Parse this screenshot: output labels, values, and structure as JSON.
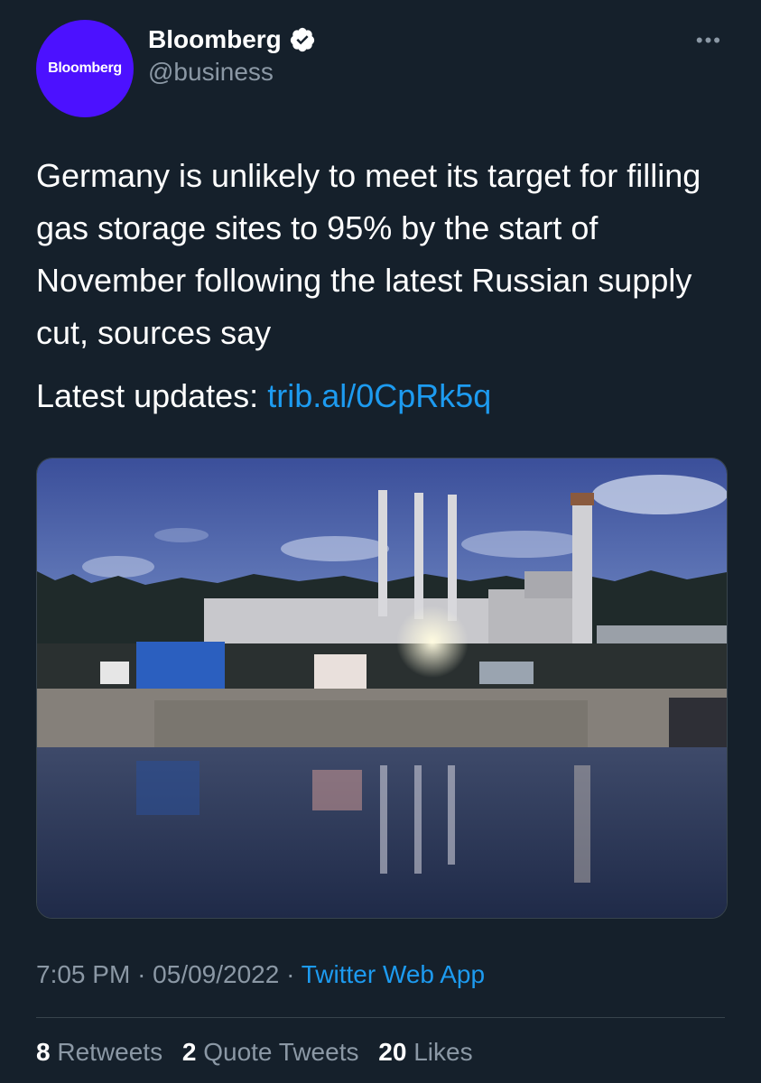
{
  "author": {
    "avatar_text": "Bloomberg",
    "display_name": "Bloomberg",
    "handle": "@business",
    "verified": true
  },
  "icons": {
    "verified": "verified-badge-icon",
    "more": "more-options-icon"
  },
  "more_label": "•••",
  "tweet": {
    "text": "Germany is unlikely to meet its target for filling gas storage sites to 95% by the start of November following the latest Russian supply cut, sources say",
    "updates_label": "Latest updates:",
    "link_text": "trib.al/0CpRk5q"
  },
  "meta": {
    "time": "7:05 PM",
    "separator": "·",
    "date": "05/09/2022",
    "source": "Twitter Web App"
  },
  "stats": {
    "retweets_count": "8",
    "retweets_label": "Retweets",
    "quotes_count": "2",
    "quotes_label": "Quote Tweets",
    "likes_count": "20",
    "likes_label": "Likes"
  },
  "colors": {
    "background": "#15202b",
    "secondary_text": "#8b98a5",
    "link": "#1d9bf0",
    "avatar_bg": "#4c11ff"
  }
}
